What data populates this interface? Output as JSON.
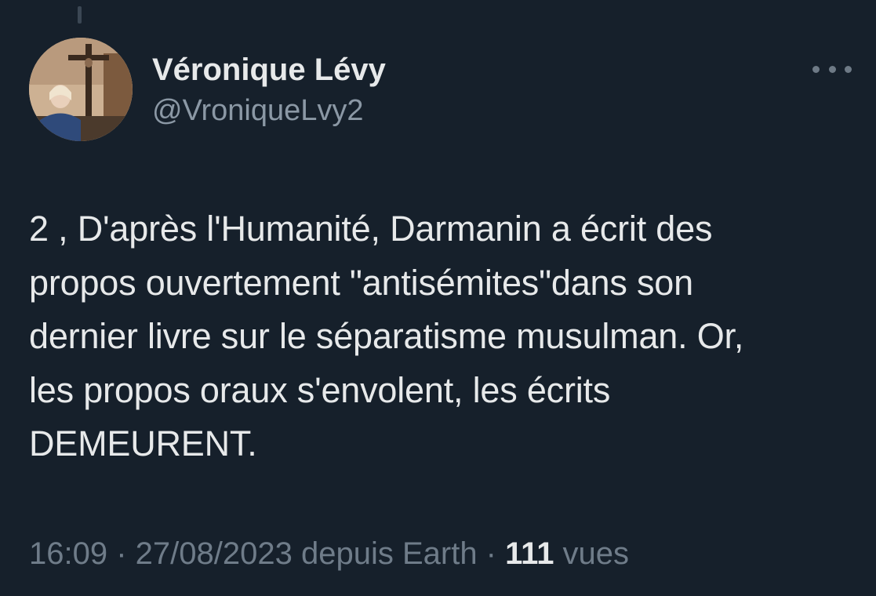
{
  "tweet": {
    "author": {
      "display_name": "Véronique Lévy",
      "handle": "@VroniqueLvy2"
    },
    "text": "2 , D'après l'Humanité, Darmanin a écrit des\npropos ouvertement \"antisémites\"dans son\ndernier livre sur le séparatisme musulman. Or,\nles propos oraux s'envolent, les écrits\nDEMEURENT.",
    "meta": {
      "time": "16:09",
      "separator": " · ",
      "date": "27/08/2023",
      "source": " depuis Earth",
      "separator2": " · ",
      "views_count": "111",
      "views_label": " vues"
    }
  },
  "icons": {
    "more": "more-horizontal-icon"
  },
  "colors": {
    "background": "#16202b",
    "text_primary": "#e7e9ea",
    "text_secondary": "#8b98a5"
  }
}
